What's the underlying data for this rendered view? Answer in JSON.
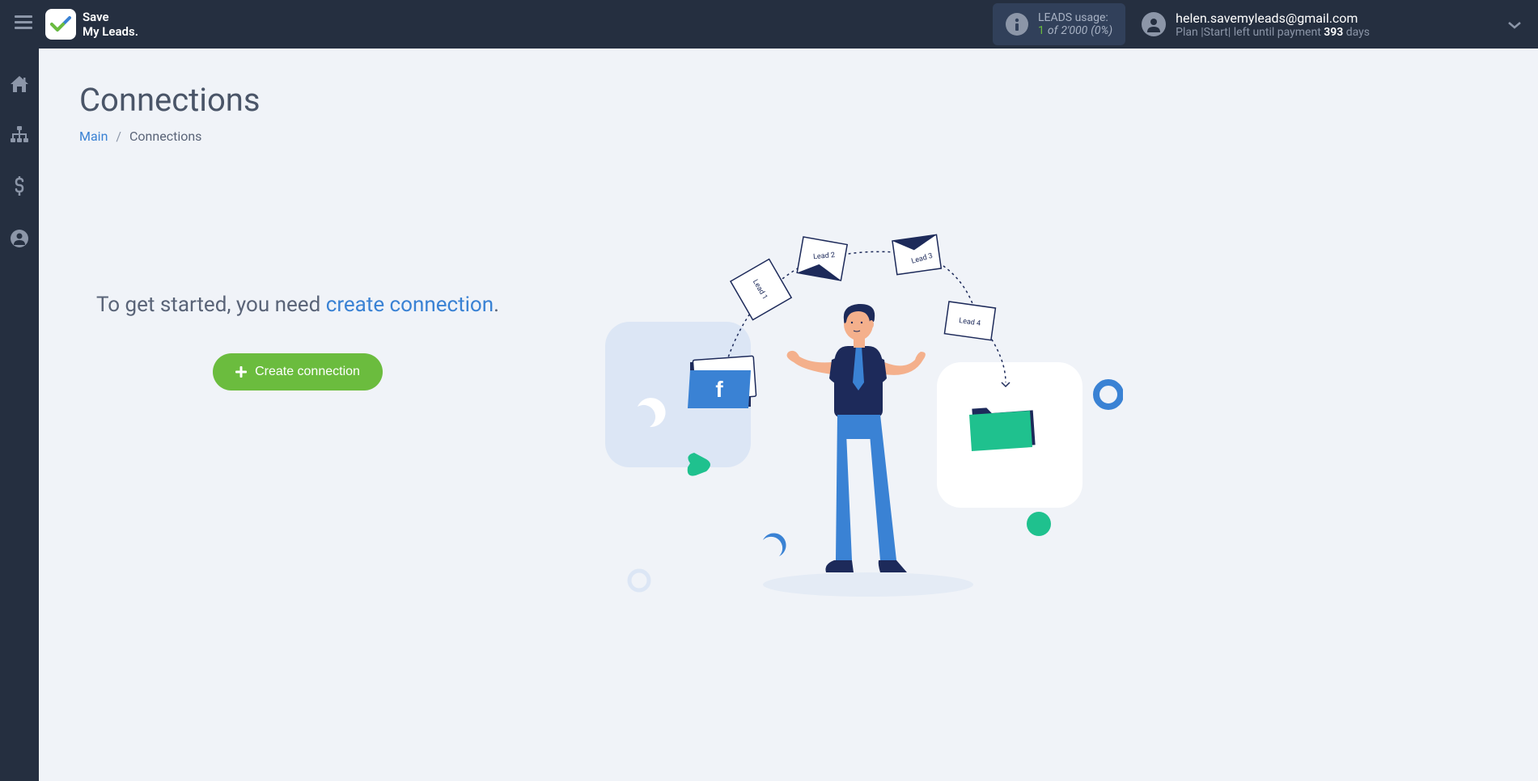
{
  "header": {
    "logo_line1": "Save",
    "logo_line2": "My Leads.",
    "usage": {
      "label": "LEADS usage:",
      "current": "1",
      "of": "of",
      "total": "2'000",
      "percent": "(0%)"
    },
    "user": {
      "email": "helen.savemyleads@gmail.com",
      "plan_prefix": "Plan |Start| left until payment ",
      "days": "393",
      "days_suffix": " days"
    }
  },
  "page": {
    "title": "Connections",
    "breadcrumb": {
      "main": "Main",
      "current": "Connections"
    },
    "cta": {
      "text_before": "To get started, you need ",
      "link_text": "create connection",
      "text_after": ".",
      "button_label": "Create connection"
    }
  },
  "illustration": {
    "leads": [
      "Lead 1",
      "Lead 2",
      "Lead 3",
      "Lead 4"
    ]
  }
}
